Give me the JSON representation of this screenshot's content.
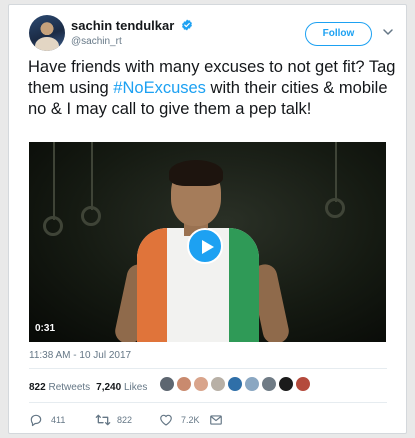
{
  "user": {
    "name": "sachin tendulkar",
    "handle": "@sachin_rt"
  },
  "follow_label": "Follow",
  "tweet": {
    "text_before": "Have friends with many excuses to not get fit? Tag them using ",
    "hashtag": "#NoExcuses",
    "text_after": " with their cities & mobile no & I may call to give them a pep talk!"
  },
  "video": {
    "duration": "0:31"
  },
  "timestamp": "11:38 AM - 10 Jul 2017",
  "stats": {
    "retweets_count": "822",
    "retweets_label": "Retweets",
    "likes_count": "7,240",
    "likes_label": "Likes"
  },
  "likers": [
    {
      "color": "#5d6670"
    },
    {
      "color": "#c98a6e"
    },
    {
      "color": "#d9a48b"
    },
    {
      "color": "#b8b0a6"
    },
    {
      "color": "#2f6fa8"
    },
    {
      "color": "#8aa7c2"
    },
    {
      "color": "#6f7b85"
    },
    {
      "color": "#1b1b1b"
    },
    {
      "color": "#b44a3c"
    }
  ],
  "actions": {
    "reply_count": "411",
    "retweet_count": "822",
    "like_count": "7.2K"
  },
  "icons": {
    "verified": "verified-badge-icon",
    "more": "chevron-down-icon",
    "play": "play-icon",
    "reply": "reply-icon",
    "retweet": "retweet-icon",
    "like": "heart-icon",
    "message": "envelope-icon"
  },
  "colors": {
    "accent": "#1da1f2",
    "muted": "#657786"
  }
}
